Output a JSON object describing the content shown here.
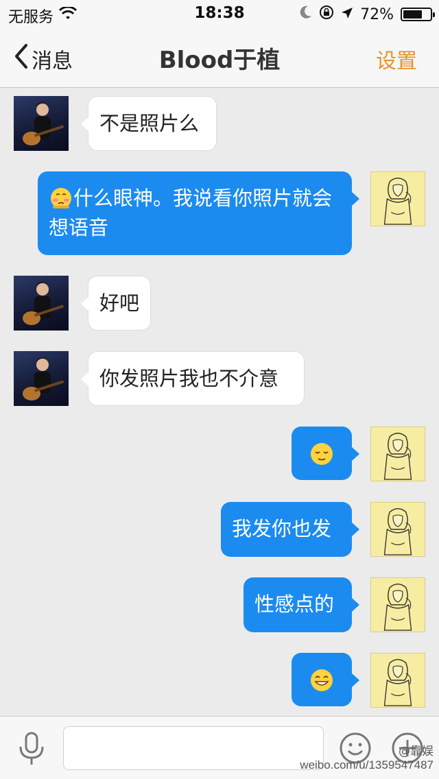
{
  "status_bar": {
    "carrier": "无服务",
    "time": "18:38",
    "battery": "72%",
    "battery_level": 0.72
  },
  "nav": {
    "back_label": "消息",
    "title": "Blood于植",
    "settings_label": "设置"
  },
  "messages": [
    {
      "side": "in",
      "text": "不是照片么"
    },
    {
      "side": "out",
      "emoji": "blush-face-emoji",
      "text": "什么眼神。我说看你照片就会想语音"
    },
    {
      "side": "in",
      "text": "好吧"
    },
    {
      "side": "in",
      "text": "你发照片我也不介意"
    },
    {
      "side": "out",
      "emoji": "relieved-face-emoji",
      "text": ""
    },
    {
      "side": "out",
      "text": "我发你也发"
    },
    {
      "side": "out",
      "text": "性感点的"
    },
    {
      "side": "out",
      "emoji": "grinning-face-emoji",
      "text": ""
    }
  ],
  "input": {
    "placeholder": ""
  },
  "watermark": {
    "handle": "@靠娱",
    "url": "weibo.com/u/1359547487"
  },
  "colors": {
    "outgoing_bubble": "#1b8bf0",
    "incoming_bubble": "#ffffff",
    "accent": "#e8922c",
    "background": "#ebebeb"
  },
  "icons": [
    "wifi-icon",
    "moon-icon",
    "rotation-lock-icon",
    "location-arrow-icon",
    "battery-icon",
    "back-chevron-icon",
    "mic-icon",
    "emoji-icon",
    "plus-icon"
  ]
}
